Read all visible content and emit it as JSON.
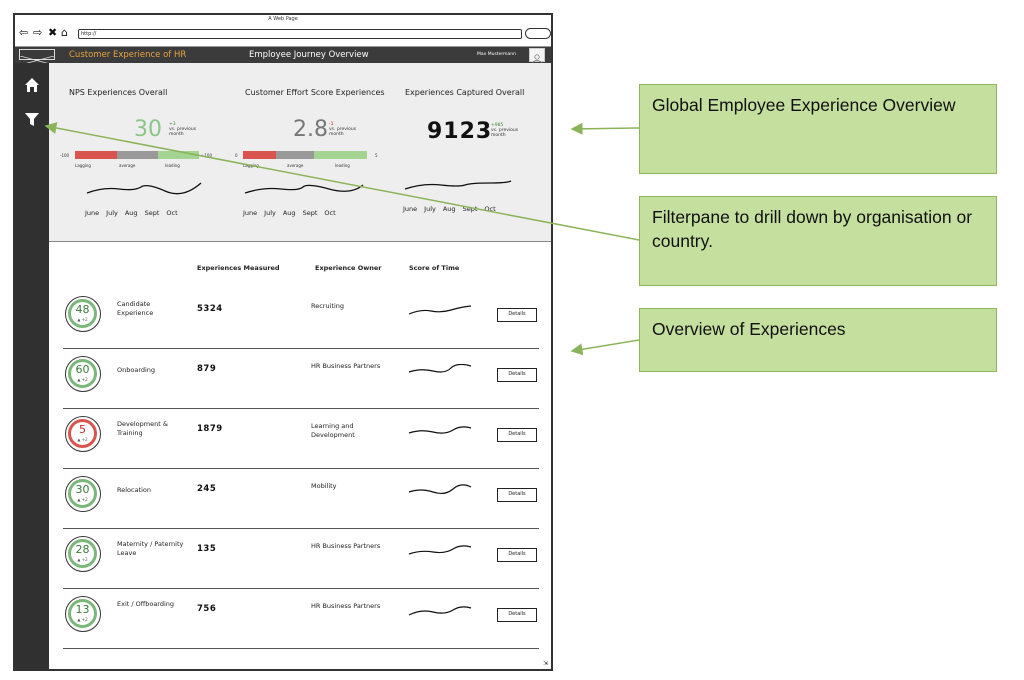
{
  "browser": {
    "window_title": "A Web Page",
    "url": "http://"
  },
  "header": {
    "app_title": "Customer Experience of HR",
    "page_title": "Employee Journey Overview",
    "user_name": "Max Mustermann"
  },
  "colors": {
    "accent": "#e8a33d",
    "header_bg": "#3b3b3b",
    "sidebar_bg": "#303030",
    "good": "#7cb77a",
    "bad": "#d9534f",
    "note_bg": "#c5df9e"
  },
  "sidebar": {
    "items": [
      {
        "icon": "home-icon"
      },
      {
        "icon": "filter-icon"
      }
    ]
  },
  "kpis": [
    {
      "title": "NPS Experiences Overall",
      "value": "30",
      "delta": "+3",
      "delta_caption": "vs. previous month",
      "scale_min": "-100",
      "scale_max": "+100",
      "bands": [
        "Lagging",
        "average",
        "leading"
      ],
      "months": [
        "June",
        "July",
        "Aug",
        "Sept",
        "Oct"
      ]
    },
    {
      "title": "Customer Effort Score Experiences",
      "value": "2.8",
      "delta": "-1",
      "delta_caption": "vs. previous month",
      "scale_min": "0",
      "scale_max": "5",
      "bands": [
        "Lagging",
        "average",
        "leading"
      ],
      "months": [
        "June",
        "July",
        "Aug",
        "Sept",
        "Oct"
      ]
    },
    {
      "title": "Experiences Captured Overall",
      "value": "9123",
      "delta": "+985",
      "delta_caption": "vs. previous month",
      "months": [
        "June",
        "July",
        "Aug",
        "Sept",
        "Oct"
      ]
    }
  ],
  "table": {
    "headers": {
      "measured": "Experiences Measured",
      "owner": "Experience Owner",
      "trend": "Score of Time"
    },
    "details_label": "Details",
    "rows": [
      {
        "score": "48",
        "delta": "+2",
        "status": "good",
        "name": "Candidate Experience",
        "measured": "5324",
        "owner": "Recruiting"
      },
      {
        "score": "60",
        "delta": "+2",
        "status": "good",
        "name": "Onboarding",
        "measured": "879",
        "owner": "HR Business Partners"
      },
      {
        "score": "5",
        "delta": "+2",
        "status": "bad",
        "name": "Development & Training",
        "measured": "1879",
        "owner": "Learning and Development"
      },
      {
        "score": "30",
        "delta": "+2",
        "status": "good",
        "name": "Relocation",
        "measured": "245",
        "owner": "Mobility"
      },
      {
        "score": "28",
        "delta": "+2",
        "status": "good",
        "name": "Maternity / Paternity Leave",
        "measured": "135",
        "owner": "HR Business Partners"
      },
      {
        "score": "13",
        "delta": "+2",
        "status": "good",
        "name": "Exit / Offboarding",
        "measured": "756",
        "owner": "HR Business Partners"
      }
    ]
  },
  "annotations": [
    {
      "text": "Global Employee Experience Overview"
    },
    {
      "text": "Filterpane to drill down by organisation or country."
    },
    {
      "text": "Overview of Experiences"
    }
  ]
}
